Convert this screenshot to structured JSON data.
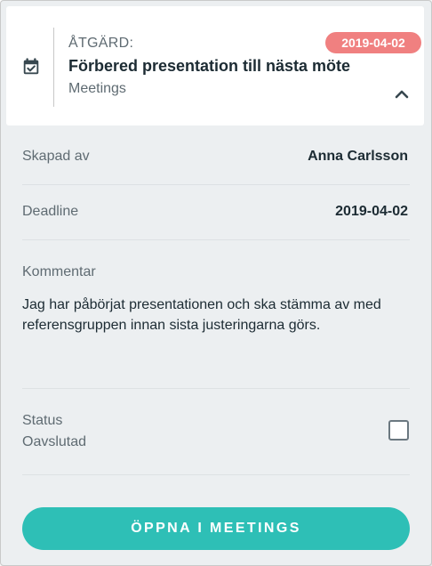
{
  "header": {
    "label": "ÅTGÄRD:",
    "title": "Förbered presentation till nästa möte",
    "subtitle": "Meetings",
    "date_badge": "2019-04-02",
    "icon": "calendar-check-icon",
    "collapse_icon": "chevron-up-icon"
  },
  "details": {
    "created_by_label": "Skapad av",
    "created_by_value": "Anna Carlsson",
    "deadline_label": "Deadline",
    "deadline_value": "2019-04-02",
    "comment_label": "Kommentar",
    "comment_text": "Jag har påbörjat presentationen och ska stämma av med referensgruppen innan sista justeringarna görs.",
    "status_label": "Status",
    "status_value": "Oavslutad",
    "status_checked": false
  },
  "actions": {
    "open_button_label": "ÖPPNA I MEETINGS"
  },
  "colors": {
    "accent": "#2ebfb6",
    "badge": "#f08080",
    "icon": "#37474f",
    "background": "#eceff1"
  }
}
